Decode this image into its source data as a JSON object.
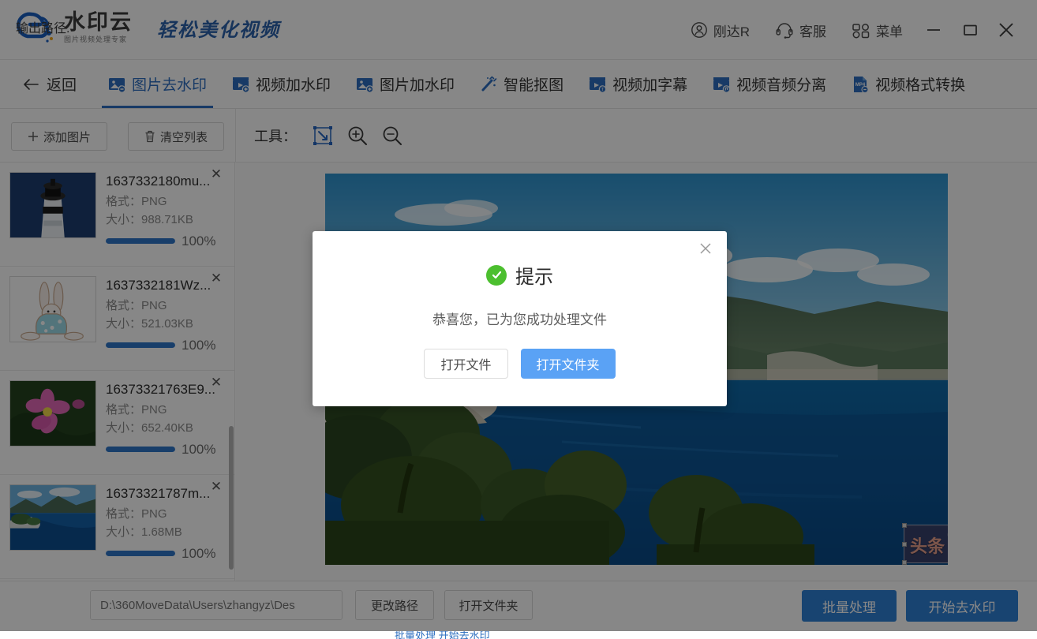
{
  "header": {
    "logo_name": "水印云",
    "logo_sub": "图片视频处理专家",
    "slogan": "轻松美化视频",
    "user_name": "刚达R",
    "support_label": "客服",
    "menu_label": "菜单",
    "minimize_label": "—",
    "maximize_label": "□",
    "close_label": "✕",
    "accent_color": "#2e6fc0"
  },
  "nav": {
    "back_label": "返回",
    "tabs": [
      {
        "label": "图片去水印",
        "icon": "image-remove-watermark-icon",
        "active": true
      },
      {
        "label": "视频加水印",
        "icon": "video-add-watermark-icon",
        "active": false
      },
      {
        "label": "图片加水印",
        "icon": "image-add-watermark-icon",
        "active": false
      },
      {
        "label": "智能抠图",
        "icon": "magic-wand-icon",
        "active": false
      },
      {
        "label": "视频加字幕",
        "icon": "video-subtitle-icon",
        "active": false
      },
      {
        "label": "视频音频分离",
        "icon": "video-audio-split-icon",
        "active": false
      },
      {
        "label": "视频格式转换",
        "icon": "mp4-convert-icon",
        "active": false
      }
    ]
  },
  "toolbar": {
    "add_image_label": "添加图片",
    "clear_list_label": "清空列表",
    "tools_label": "工具：",
    "tools": [
      {
        "name": "selection-tool",
        "active": true
      },
      {
        "name": "zoom-in-tool",
        "active": false
      },
      {
        "name": "zoom-out-tool",
        "active": false
      }
    ]
  },
  "file_list": {
    "format_label": "格式：",
    "size_label": "大小：",
    "items": [
      {
        "name": "1637332180mu...",
        "format": "PNG",
        "size": "988.71KB",
        "progress": "100%",
        "progress_value": 100,
        "thumb": "lighthouse"
      },
      {
        "name": "1637332181Wz...",
        "format": "PNG",
        "size": "521.03KB",
        "progress": "100%",
        "progress_value": 100,
        "thumb": "rabbit"
      },
      {
        "name": "16373321763E9...",
        "format": "PNG",
        "size": "652.40KB",
        "progress": "100%",
        "progress_value": 100,
        "thumb": "flower"
      },
      {
        "name": "16373321787m...",
        "format": "PNG",
        "size": "1.68MB",
        "progress": "100%",
        "progress_value": 100,
        "thumb": "coast"
      }
    ]
  },
  "preview": {
    "watermark_text": "头条 @乐学优课",
    "delete_icon": "trash-icon"
  },
  "bottom": {
    "output_path_label": "输出路径:",
    "output_path_value": "D:\\360MoveData\\Users\\zhangyz\\Des",
    "change_path_label": "更改路径",
    "open_folder_label": "打开文件夹",
    "batch_label": "批量处理",
    "start_label": "开始去水印",
    "strip_text": "批量处理    开始去水印"
  },
  "modal": {
    "title": "提示",
    "message": "恭喜您，已为您成功处理文件",
    "open_file_label": "打开文件",
    "open_folder_label": "打开文件夹",
    "close_label": "✕",
    "success_color": "#4cbf2f",
    "primary_color": "#5aa2f5"
  }
}
